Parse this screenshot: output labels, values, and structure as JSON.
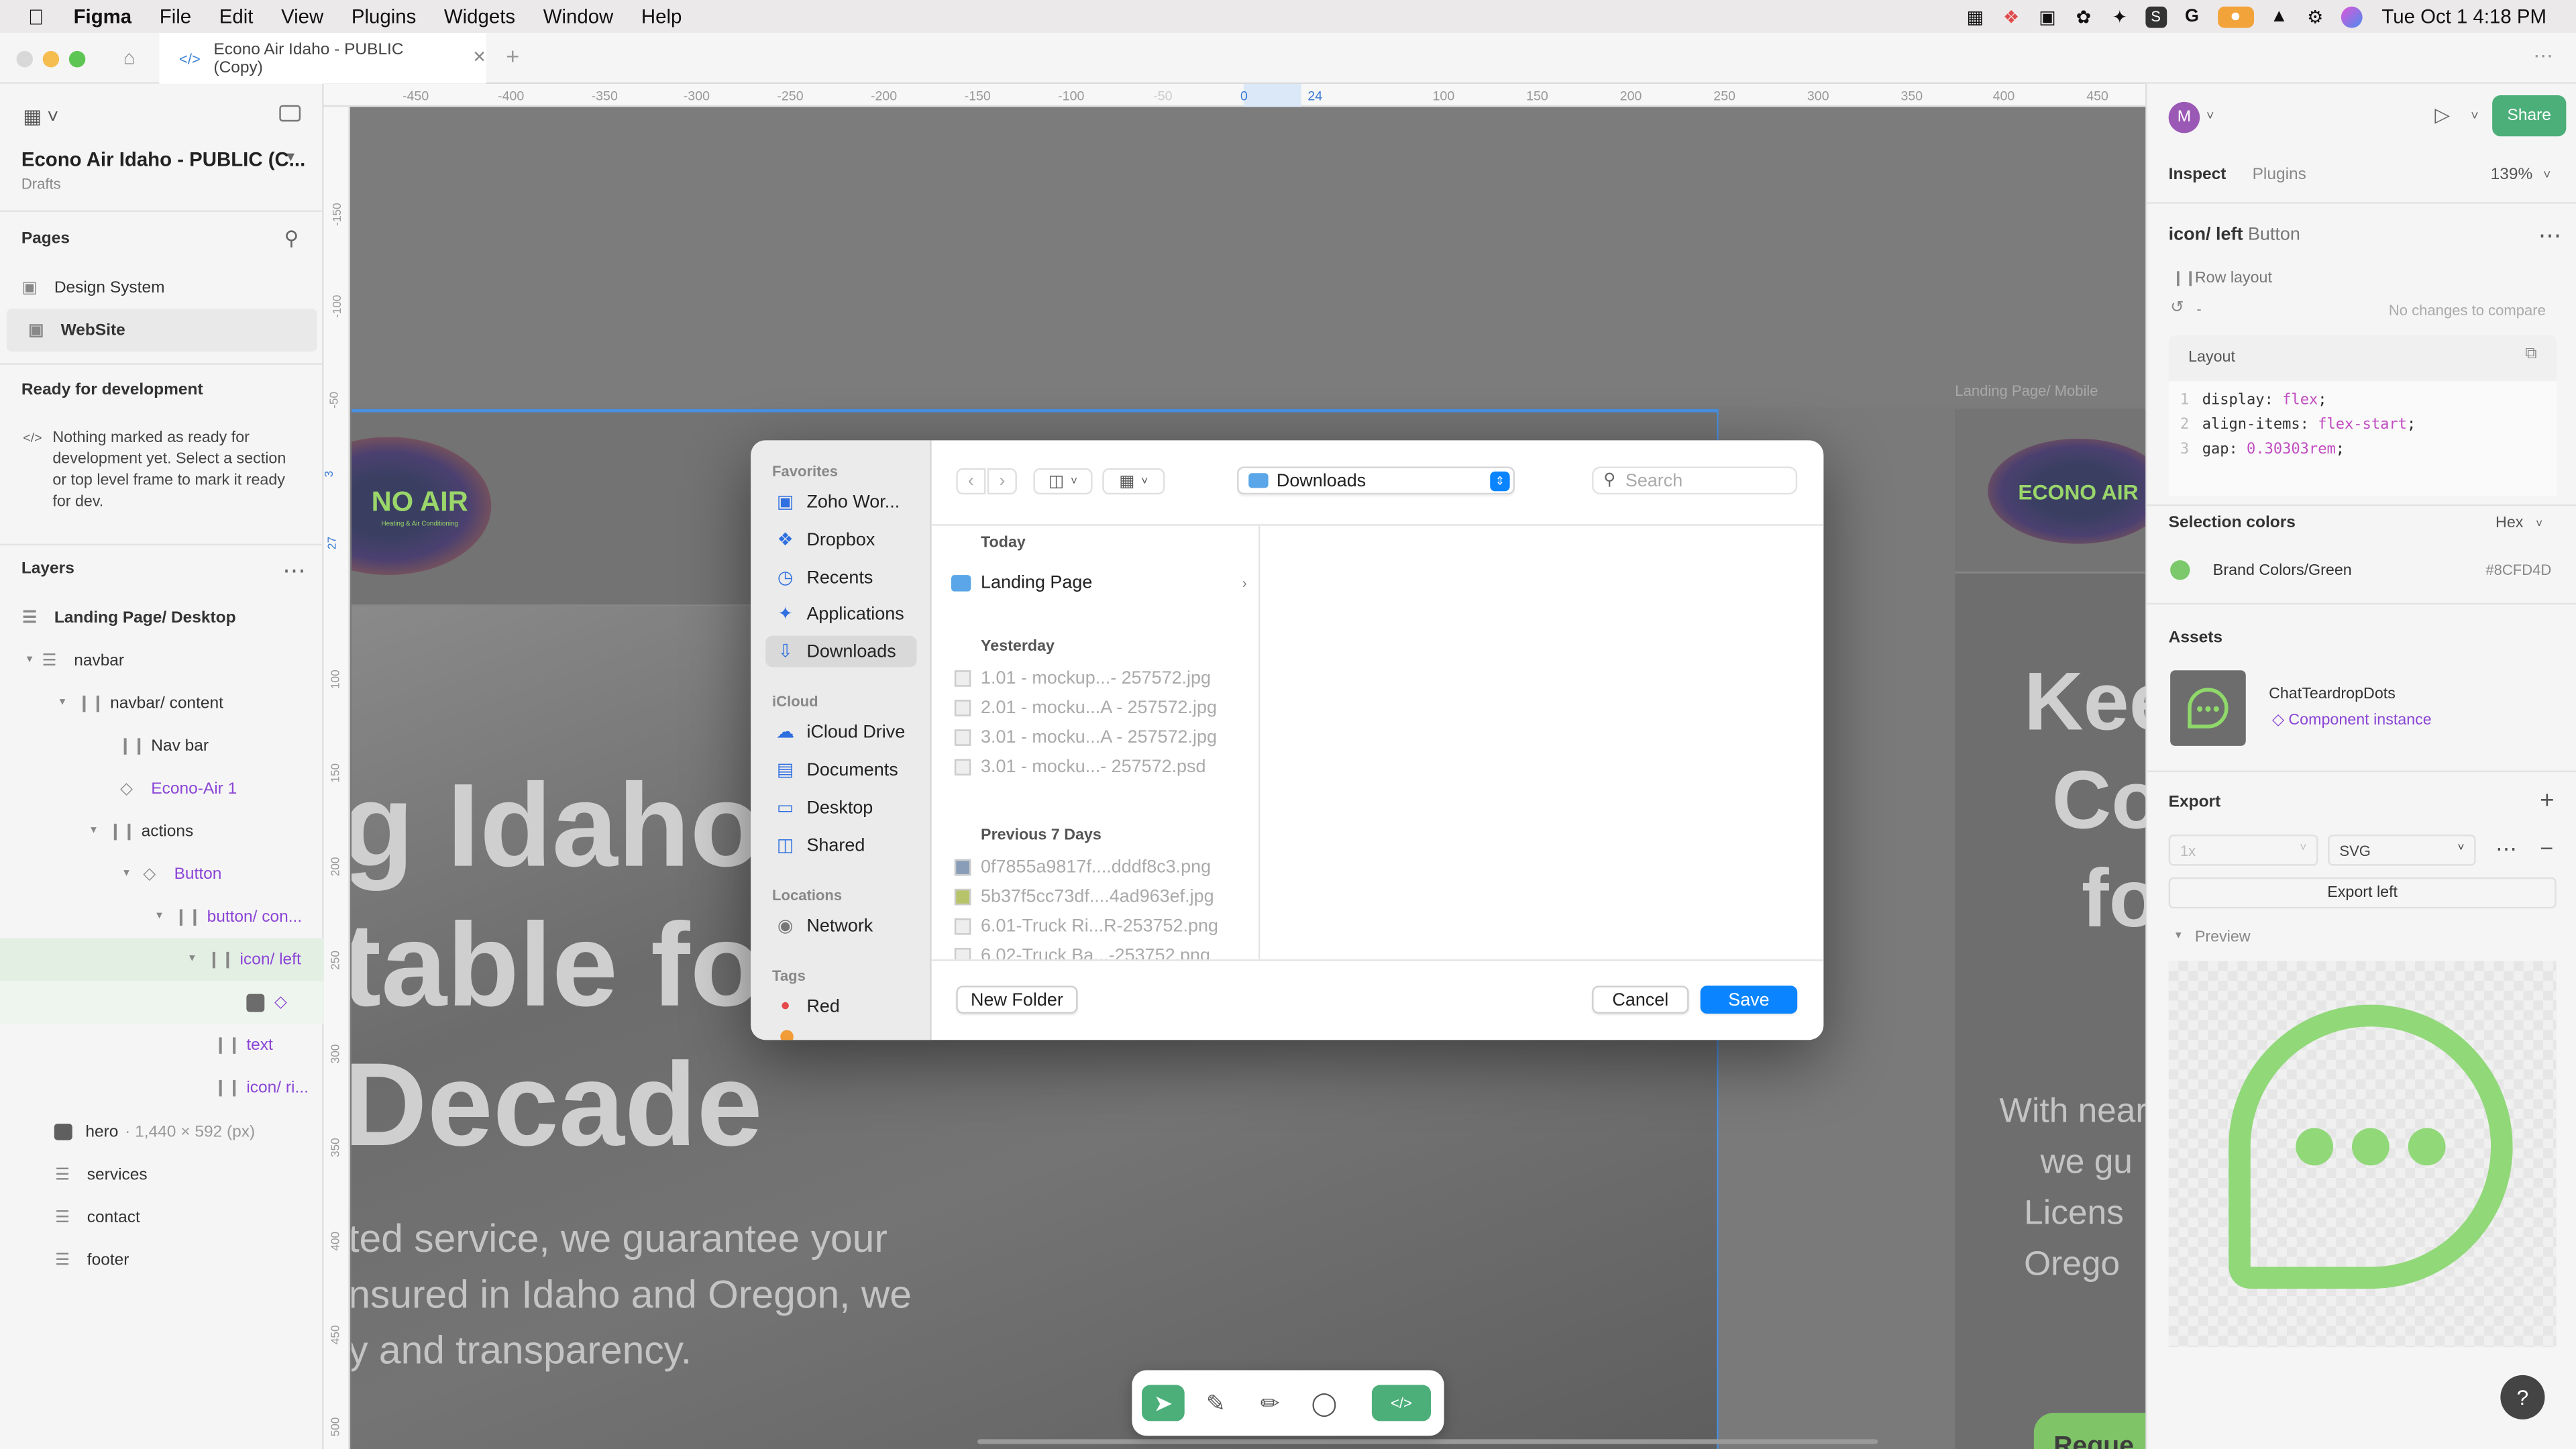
{
  "menubar": {
    "app": "Figma",
    "items": [
      "File",
      "Edit",
      "View",
      "Plugins",
      "Widgets",
      "Window",
      "Help"
    ],
    "datetime": "Tue Oct 1  4:18 PM"
  },
  "tab": {
    "title": "Econo Air Idaho - PUBLIC (Copy)"
  },
  "left_panel": {
    "file_name": "Econo Air Idaho - PUBLIC (C...",
    "location": "Drafts",
    "pages_title": "Pages",
    "pages": [
      "Design System",
      "WebSite"
    ],
    "ready_title": "Ready for development",
    "ready_text": "Nothing marked as ready for development yet. Select a section or top level frame to mark it ready for dev.",
    "layers_title": "Layers",
    "layers": [
      {
        "label": "Landing Page/ Desktop",
        "icon": "frame-icon"
      },
      {
        "label": "navbar",
        "icon": "frame-icon"
      },
      {
        "label": "navbar/ content",
        "icon": "autolayout-icon"
      },
      {
        "label": "Nav bar",
        "icon": "autolayout-icon"
      },
      {
        "label": "Econo-Air 1",
        "icon": "component-icon"
      },
      {
        "label": "actions",
        "icon": "autolayout-icon"
      },
      {
        "label": "Button",
        "icon": "component-icon"
      },
      {
        "label": "button/ con...",
        "icon": "autolayout-icon"
      },
      {
        "label": "icon/ left",
        "icon": "autolayout-icon"
      },
      {
        "label": "",
        "icon": "instance-icon"
      },
      {
        "label": "text",
        "icon": "autolayout-icon"
      },
      {
        "label": "icon/ ri...",
        "icon": "autolayout-icon"
      },
      {
        "label": "hero",
        "icon": "image-icon"
      },
      {
        "label": "services",
        "icon": "frame-icon"
      },
      {
        "label": "contact",
        "icon": "frame-icon"
      },
      {
        "label": "footer",
        "icon": "frame-icon"
      }
    ],
    "hero_dims": "1,440 × 592 (px)"
  },
  "canvas": {
    "ruler_top": [
      "-450",
      "-400",
      "-350",
      "-300",
      "-250",
      "-200",
      "-150",
      "-100",
      "-50",
      "0",
      "24",
      "100",
      "150",
      "200",
      "250",
      "300",
      "350",
      "400",
      "450"
    ],
    "ruler_left": [
      "-150",
      "-100",
      "-50",
      "3",
      "27",
      "100",
      "150",
      "200",
      "250",
      "300",
      "350",
      "400",
      "450",
      "500"
    ],
    "hero_heading_lines": [
      "g Idaho",
      "table fo",
      "Decade"
    ],
    "hero_sub_lines": [
      "ted service, we guarantee your",
      "nsured in Idaho and Oregon, we",
      "y and transparency."
    ],
    "logo_text": "NO AIR",
    "logo_sub": "Heating & Air Conditioning",
    "mobile_label": "Landing Page/ Mobile",
    "mobile_logo_text": "ECONO AIR",
    "mobile_heading_lines": [
      "Kee",
      "Co",
      "fo"
    ],
    "mobile_sub_lines": [
      "With near",
      "we gu",
      "Licens",
      "Orego"
    ],
    "mobile_button": "Reque"
  },
  "dialog": {
    "favorites_title": "Favorites",
    "favorites": [
      {
        "label": "Zoho Wor...",
        "icon": "zoho-icon"
      },
      {
        "label": "Dropbox",
        "icon": "dropbox-icon"
      },
      {
        "label": "Recents",
        "icon": "clock-icon"
      },
      {
        "label": "Applications",
        "icon": "applications-icon"
      },
      {
        "label": "Downloads",
        "icon": "downloads-icon"
      }
    ],
    "icloud_title": "iCloud",
    "icloud": [
      {
        "label": "iCloud Drive",
        "icon": "cloud-icon"
      },
      {
        "label": "Documents",
        "icon": "document-icon"
      },
      {
        "label": "Desktop",
        "icon": "desktop-icon"
      },
      {
        "label": "Shared",
        "icon": "shared-folder-icon"
      }
    ],
    "locations_title": "Locations",
    "locations": [
      {
        "label": "Network",
        "icon": "globe-icon"
      }
    ],
    "tags_title": "Tags",
    "tags": [
      {
        "label": "Red",
        "color": "#e5484d"
      }
    ],
    "location": "Downloads",
    "search_placeholder": "Search",
    "groups": [
      {
        "title": "Today",
        "items": [
          "Landing Page"
        ]
      },
      {
        "title": "Yesterday",
        "items": [
          "1.01 - mockup...- 257572.jpg",
          "2.01 - mocku...A - 257572.jpg",
          "3.01 - mocku...A - 257572.jpg",
          "3.01 - mocku...- 257572.psd"
        ]
      },
      {
        "title": "Previous 7 Days",
        "items": [
          "0f7855a9817f....dddf8c3.png",
          "5b37f5cc73df....4ad963ef.jpg",
          "6.01-Truck Ri...R-253752.png",
          "6.02-Truck Ba...-253752.png"
        ]
      }
    ],
    "new_folder": "New Folder",
    "cancel": "Cancel",
    "save": "Save"
  },
  "right_panel": {
    "avatar": "M",
    "share": "Share",
    "tabs": [
      "Inspect",
      "Plugins"
    ],
    "zoom": "139%",
    "selection_name": "icon/ left",
    "selection_type": "Button",
    "row_layout": "Row layout",
    "history_dash": "-",
    "no_changes": "No changes to compare",
    "layout_title": "Layout",
    "code_lines": [
      {
        "num": "1",
        "prop": "display: ",
        "val": "flex",
        "end": ";"
      },
      {
        "num": "2",
        "prop": "align-items: ",
        "val": "flex-start",
        "end": ";"
      },
      {
        "num": "3",
        "prop": "gap: ",
        "val": "0.30303rem",
        "end": ";"
      }
    ],
    "selection_colors": "Selection colors",
    "color_format": "Hex",
    "color_name": "Brand Colors/Green",
    "color_hex": "#8CFD4D",
    "assets_title": "Assets",
    "asset_name": "ChatTeardropDots",
    "asset_type": "Component instance",
    "export_title": "Export",
    "export_scale": "1x",
    "export_format": "SVG",
    "export_button": "Export left",
    "preview_title": "Preview",
    "help": "?"
  },
  "colors": {
    "accent": "#0a84ff",
    "figma_green": "#4caf7a",
    "brand_green": "#8CFD4D",
    "purple": "#8b45d6"
  }
}
